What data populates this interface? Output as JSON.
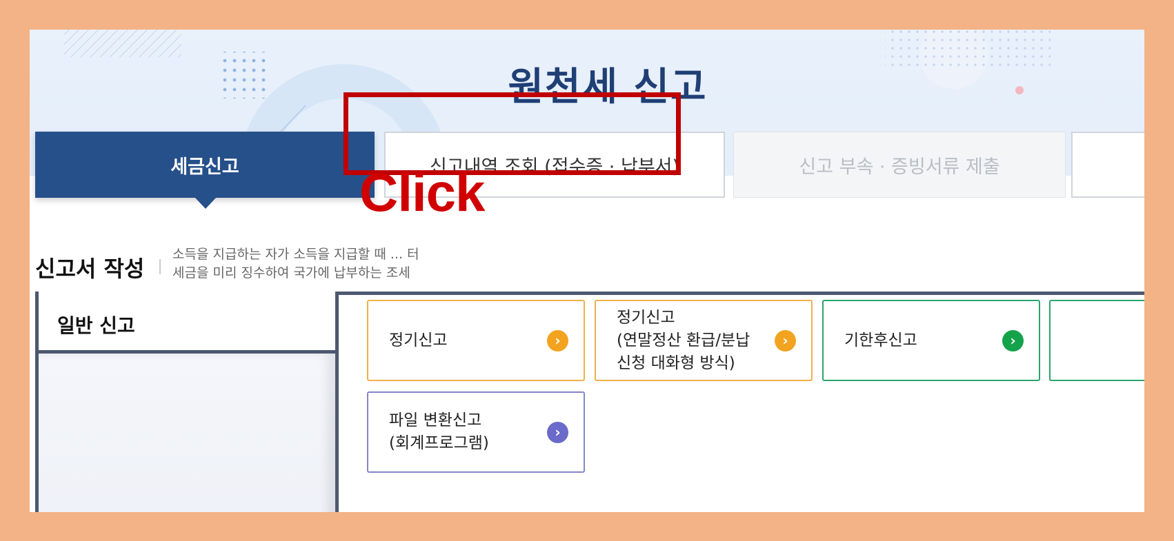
{
  "page": {
    "title": "원천세 신고",
    "colors": {
      "frame": "#f3b386",
      "primary": "#26508a",
      "highlight": "#c00000"
    }
  },
  "tabs": [
    {
      "label": "세금신고",
      "state": "active"
    },
    {
      "label": "신고내역 조회 (접수증 · 납부서)",
      "state": "highlighted"
    },
    {
      "label": "신고 부속 · 증빙서류 제출",
      "state": "disabled"
    },
    {
      "label": "",
      "state": "partial"
    }
  ],
  "annotation": {
    "click_label": "Click"
  },
  "section": {
    "title": "신고서 작성",
    "description_line1": "소득을 지급하는 자가 소득을 지급할 때 ... 터",
    "description_line2": "세금을 미리 징수하여 국가에 납부하는 조세"
  },
  "left_panel": {
    "header": "일반 신고"
  },
  "cards": [
    {
      "label": "정기신고",
      "color": "orange",
      "icon": "chevron-right-icon"
    },
    {
      "label": "정기신고\n(연말정산 환급/분납\n신청 대화형 방식)",
      "color": "orange",
      "icon": "chevron-right-icon"
    },
    {
      "label": "기한후신고",
      "color": "green",
      "icon": "chevron-right-icon"
    },
    {
      "label": "파일 변환신고\n(회계프로그램)",
      "color": "purple",
      "icon": "chevron-right-icon"
    }
  ]
}
